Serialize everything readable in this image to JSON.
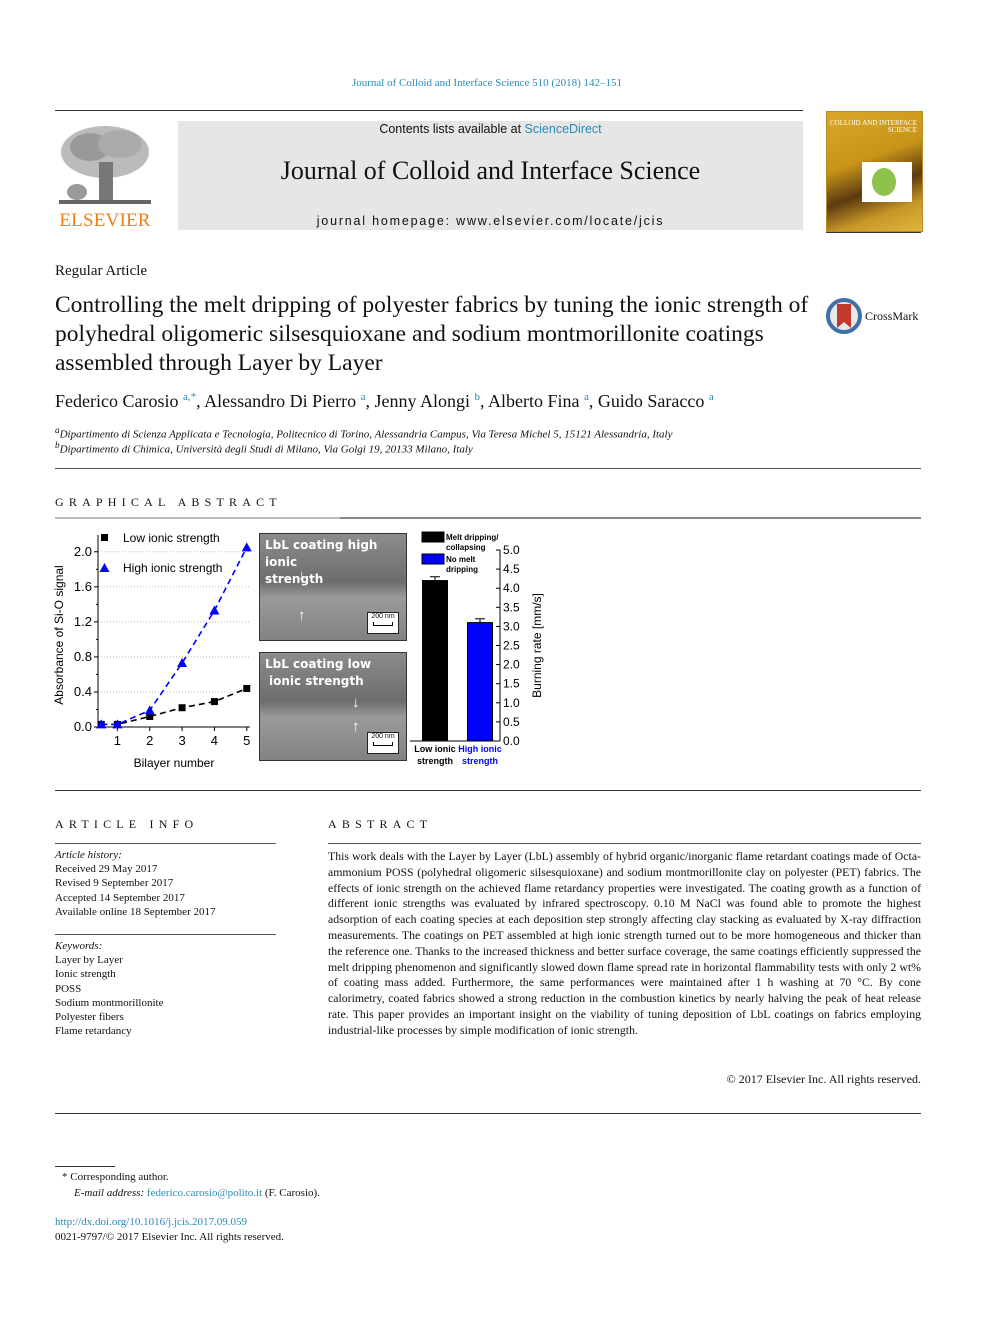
{
  "header": {
    "citation": "Journal of Colloid and Interface Science 510 (2018) 142–151",
    "publisher_logo_text": "ELSEVIER",
    "contents_prefix": "Contents lists available at ",
    "contents_link": "ScienceDirect",
    "journal_title": "Journal of Colloid and Interface Science",
    "homepage": "journal homepage: www.elsevier.com/locate/jcis",
    "cover_title": "COLLOID AND INTERFACE SCIENCE"
  },
  "article": {
    "type": "Regular Article",
    "title": "Controlling the melt dripping of polyester fabrics by tuning the ionic strength of polyhedral oligomeric silsesquioxane and sodium montmorillonite coatings assembled through Layer by Layer",
    "crossmark_label": "CrossMark",
    "authors": [
      {
        "name": "Federico Carosio",
        "sup": "a,*"
      },
      {
        "name": "Alessandro Di Pierro",
        "sup": "a"
      },
      {
        "name": "Jenny Alongi",
        "sup": "b"
      },
      {
        "name": "Alberto Fina",
        "sup": "a"
      },
      {
        "name": "Guido Saracco",
        "sup": "a"
      }
    ],
    "affiliations": [
      {
        "sup": "a",
        "text": "Dipartimento di Scienza Applicata e Tecnologia, Politecnico di Torino, Alessandria Campus, Via Teresa Michel 5, 15121 Alessandria, Italy"
      },
      {
        "sup": "b",
        "text": "Dipartimento di Chimica, Università degli Studi di Milano, Via Golgi 19, 20133 Milano, Italy"
      }
    ]
  },
  "graphical_abstract": {
    "heading": "GRAPHICAL ABSTRACT",
    "sem_images": [
      {
        "label_line1": "LbL coating high ionic",
        "label_line2": "strength",
        "scale": "200 nm"
      },
      {
        "label_line1": "LbL coating low",
        "label_line2": "ionic strength",
        "scale": "200 nm"
      }
    ]
  },
  "chart_data": [
    {
      "type": "scatter",
      "title": "",
      "xlabel": "Bilayer number",
      "ylabel": "Absorbance of Si-O signal",
      "xlim": [
        0.4,
        5.1
      ],
      "ylim": [
        0,
        2.1
      ],
      "xticks": [
        1,
        2,
        3,
        4,
        5
      ],
      "yticks": [
        "0.0",
        "0.4",
        "0.8",
        "1.2",
        "1.6",
        "2.0"
      ],
      "grid": true,
      "legend_position": "top-left",
      "series": [
        {
          "name": "Low ionic strength",
          "marker": "square",
          "color": "#000000",
          "x": [
            0.5,
            1,
            2,
            3,
            4,
            5
          ],
          "y": [
            0.03,
            0.03,
            0.12,
            0.22,
            0.29,
            0.44
          ]
        },
        {
          "name": "High ionic strength",
          "marker": "triangle",
          "color": "#0000ff",
          "x": [
            0.5,
            1,
            2,
            3,
            4,
            5
          ],
          "y": [
            0.03,
            0.03,
            0.19,
            0.73,
            1.33,
            2.05
          ]
        }
      ]
    },
    {
      "type": "bar",
      "title": "",
      "ylabel": "Burning rate [mm/s]",
      "ylim": [
        0,
        5.0
      ],
      "yticks": [
        "0.0",
        "0.5",
        "1.0",
        "1.5",
        "2.0",
        "2.5",
        "3.0",
        "3.5",
        "4.0",
        "4.5",
        "5.0"
      ],
      "y_axis_side": "right",
      "legend_position": "top-left",
      "categories": [
        {
          "line1": "Low ionic",
          "line2": "strength",
          "color": "#000000"
        },
        {
          "line1": "High ionic",
          "line2": "strength",
          "color": "#0000ff"
        }
      ],
      "values": [
        4.2,
        3.1
      ],
      "errors": [
        0.1,
        0.1
      ],
      "legend": [
        {
          "line1": "Melt dripping/",
          "line2": "collapsing",
          "color": "#000000"
        },
        {
          "line1": "No melt",
          "line2": "dripping",
          "color": "#0000ff"
        }
      ]
    }
  ],
  "article_info": {
    "heading": "ARTICLE INFO",
    "history_label": "Article history:",
    "history": [
      "Received 29 May 2017",
      "Revised 9 September 2017",
      "Accepted 14 September 2017",
      "Available online 18 September 2017"
    ],
    "keywords_label": "Keywords:",
    "keywords": [
      "Layer by Layer",
      "Ionic strength",
      "POSS",
      "Sodium montmorillonite",
      "Polyester fibers",
      "Flame retardancy"
    ]
  },
  "abstract": {
    "heading": "ABSTRACT",
    "text": "This work deals with the Layer by Layer (LbL) assembly of hybrid organic/inorganic flame retardant coatings made of Octa-ammonium POSS (polyhedral oligomeric silsesquioxane) and sodium montmorillonite clay on polyester (PET) fabrics. The effects of ionic strength on the achieved flame retardancy properties were investigated. The coating growth as a function of different ionic strengths was evaluated by infrared spectroscopy. 0.10 M NaCl was found able to promote the highest adsorption of each coating species at each deposition step strongly affecting clay stacking as evaluated by X-ray diffraction measurements. The coatings on PET assembled at high ionic strength turned out to be more homogeneous and thicker than the reference one. Thanks to the increased thickness and better surface coverage, the same coatings efficiently suppressed the melt dripping phenomenon and significantly slowed down flame spread rate in horizontal flammability tests with only 2 wt% of coating mass added. Furthermore, the same performances were maintained after 1 h washing at 70 °C. By cone calorimetry, coated fabrics showed a strong reduction in the combustion kinetics by nearly halving the peak of heat release rate. This paper provides an important insight on the viability of tuning deposition of LbL coatings on fabrics employing industrial-like processes by simple modification of ionic strength.",
    "copyright": "© 2017 Elsevier Inc. All rights reserved."
  },
  "footer": {
    "corresponding": "* Corresponding author.",
    "email_label": "E-mail address: ",
    "email": "federico.carosio@polito.it",
    "email_suffix": " (F. Carosio).",
    "doi": "http://dx.doi.org/10.1016/j.jcis.2017.09.059",
    "issn": "0021-9797/© 2017 Elsevier Inc. All rights reserved."
  }
}
